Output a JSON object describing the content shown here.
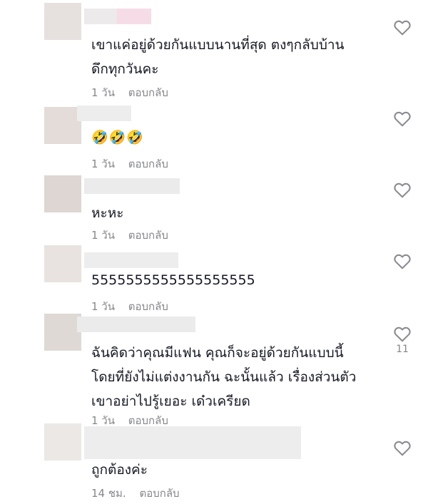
{
  "reply_label": "ตอบกลับ",
  "comments": [
    {
      "text": "เขาแค่อยู่ด้วยกันแบบนานที่สุด ตงๆกลับบ้าน\nดึกทุกวันคะ",
      "time": "1 วัน",
      "likes": ""
    },
    {
      "text": "🤣🤣🤣",
      "time": "1 วัน",
      "likes": ""
    },
    {
      "text": "หะหะ",
      "time": "1 วัน",
      "likes": ""
    },
    {
      "text": "5555555555555555555",
      "time": "1 วัน",
      "likes": ""
    },
    {
      "text": "ฉันคิดว่าคุณมีแฟน คุณก็จะอยู่ด้วยกันแบบนี้\nโดยที่ยังไม่แต่งงานกัน ฉะนั้นแล้ว เรื่องส่วนตัว\nเขาอย่าไปรู้เยอะ เด๋วเครียด",
      "time": "1 วัน",
      "likes": "11"
    },
    {
      "text": "ถูกต้องค่ะ",
      "time": "14 ชม.",
      "likes": ""
    }
  ],
  "colors": {
    "text": "#161823",
    "meta": "#86878b",
    "heart_stroke": "#8a8b91",
    "blur_avatar": "#e4dedb",
    "blur_name": "#ecebeb",
    "blur_pink": "#f6dce6"
  },
  "icons": {
    "like": "heart-outline-icon"
  }
}
